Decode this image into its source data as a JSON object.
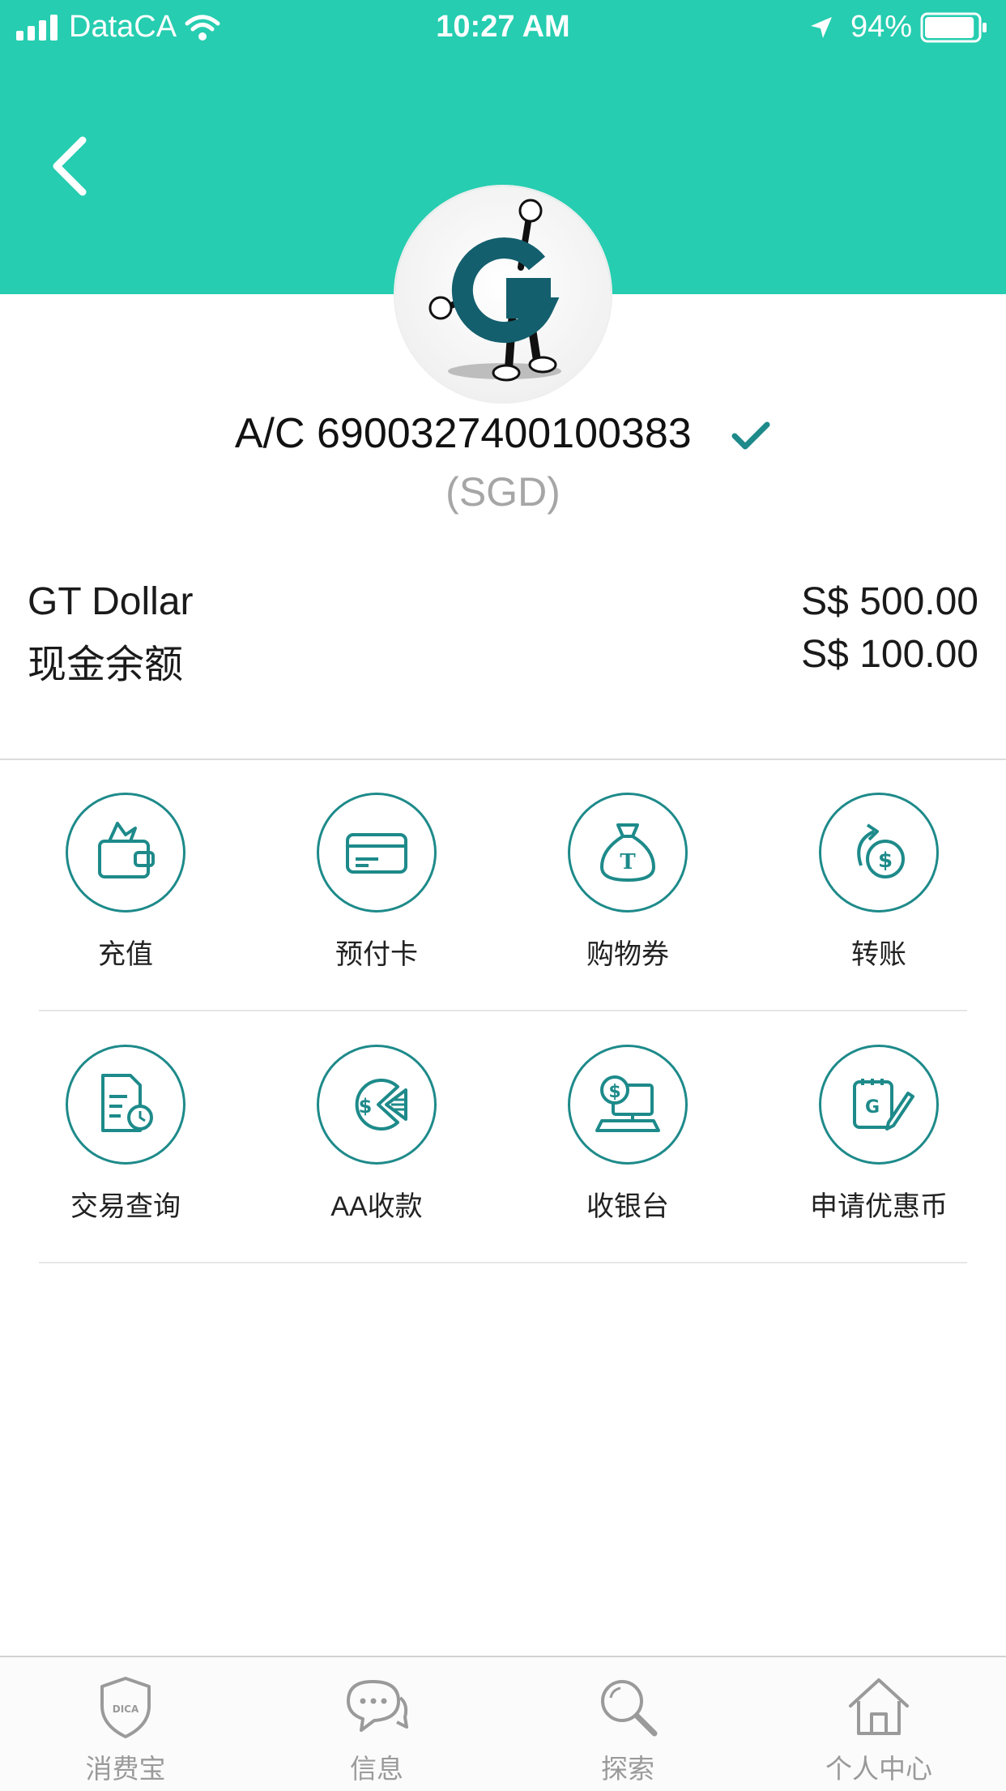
{
  "status_bar": {
    "carrier": "DataCA",
    "time": "10:27 AM",
    "battery": "94%",
    "battery_level": 0.94
  },
  "header": {
    "background_color": "#26cdb0",
    "back_icon": "chevron-left-icon"
  },
  "account": {
    "number": "A/C 6900327400100383",
    "currency": "(SGD)",
    "verified_icon": "check-icon"
  },
  "balances": [
    {
      "label": "GT Dollar",
      "value": "S$ 500.00"
    },
    {
      "label": "现金余额",
      "value": "S$ 100.00"
    }
  ],
  "actions": [
    {
      "label": "充值",
      "icon": "wallet-topup-icon"
    },
    {
      "label": "预付卡",
      "icon": "card-icon"
    },
    {
      "label": "购物券",
      "icon": "money-bag-icon"
    },
    {
      "label": "转账",
      "icon": "transfer-icon"
    },
    {
      "label": "交易查询",
      "icon": "transaction-history-icon"
    },
    {
      "label": "AA收款",
      "icon": "split-payment-icon"
    },
    {
      "label": "收银台",
      "icon": "cashier-icon"
    },
    {
      "label": "申请优惠币",
      "icon": "apply-coupon-icon"
    }
  ],
  "accent_color": "#1e8a8a",
  "tabbar": [
    {
      "label": "消费宝",
      "icon": "shield-icon",
      "badge_text": "DICA"
    },
    {
      "label": "信息",
      "icon": "chat-icon"
    },
    {
      "label": "探索",
      "icon": "search-icon"
    },
    {
      "label": "个人中心",
      "icon": "home-icon"
    }
  ]
}
